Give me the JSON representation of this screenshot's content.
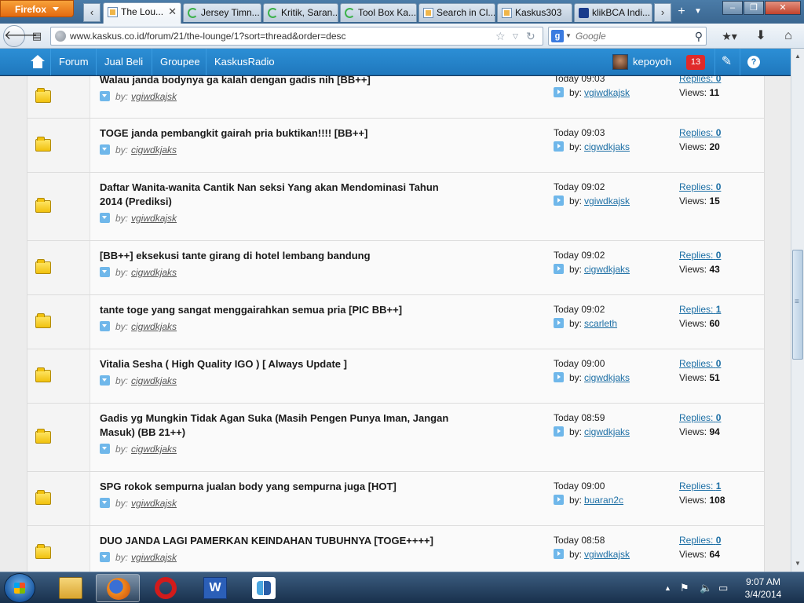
{
  "browser": {
    "menu_label": "Firefox",
    "tabs": [
      {
        "label": "The Lou...",
        "icon": "kaskus-page-icon",
        "active": true
      },
      {
        "label": "Jersey Timn...",
        "icon": "loading-icon"
      },
      {
        "label": "Kritik, Saran...",
        "icon": "loading-icon"
      },
      {
        "label": "Tool Box Ka...",
        "icon": "loading-icon"
      },
      {
        "label": "Search in Cl...",
        "icon": "kaskus-page-icon"
      },
      {
        "label": "Kaskus303",
        "icon": "kaskus-page-icon"
      },
      {
        "label": "klikBCA Indi...",
        "icon": "bca-icon"
      }
    ],
    "url": "www.kaskus.co.id/forum/21/the-lounge/1?sort=thread&order=desc",
    "search_placeholder": "Google"
  },
  "kaskus": {
    "nav": [
      "Forum",
      "Jual Beli",
      "Groupee",
      "KaskusRadio"
    ],
    "username": "kepoyoh",
    "notifications": "13"
  },
  "labels": {
    "by": "by:",
    "replies": "Replies:",
    "views": "Views:"
  },
  "threads": [
    {
      "title": "Walau janda bodynya ga kalah dengan gadis nih [BB++]",
      "author": "vgiwdkajsk",
      "time": "Today 09:03",
      "last_user": "vgiwdkajsk",
      "replies": "0",
      "views": "11"
    },
    {
      "title": "TOGE janda pembangkit gairah pria buktikan!!!! [BB++]",
      "author": "cigwdkjaks",
      "time": "Today 09:03",
      "last_user": "cigwdkjaks",
      "replies": "0",
      "views": "20"
    },
    {
      "title": "Daftar Wanita-wanita Cantik Nan seksi Yang akan Mendominasi Tahun 2014 (Prediksi)",
      "author": "vgiwdkajsk",
      "time": "Today 09:02",
      "last_user": "vgiwdkajsk",
      "replies": "0",
      "views": "15"
    },
    {
      "title": "[BB++] eksekusi tante girang di hotel lembang bandung",
      "author": "cigwdkjaks",
      "time": "Today 09:02",
      "last_user": "cigwdkjaks",
      "replies": "0",
      "views": "43"
    },
    {
      "title": "tante toge yang sangat menggairahkan semua pria [PIC BB++]",
      "author": "cigwdkjaks",
      "time": "Today 09:02",
      "last_user": "scarleth",
      "replies": "1",
      "views": "60"
    },
    {
      "title": "Vitalia Sesha ( High Quality IGO ) [ Always Update ]",
      "author": "cigwdkjaks",
      "time": "Today 09:00",
      "last_user": "cigwdkjaks",
      "replies": "0",
      "views": "51"
    },
    {
      "title": "Gadis yg Mungkin Tidak Agan Suka (Masih Pengen Punya Iman, Jangan Masuk) (BB 21++)",
      "author": "cigwdkjaks",
      "time": "Today 08:59",
      "last_user": "cigwdkjaks",
      "replies": "0",
      "views": "94"
    },
    {
      "title": "SPG rokok sempurna jualan body yang sempurna juga [HOT]",
      "author": "vgiwdkajsk",
      "time": "Today 09:00",
      "last_user": "buaran2c",
      "replies": "1",
      "views": "108"
    },
    {
      "title": "DUO JANDA LAGI PAMERKAN KEINDAHAN TUBUHNYA [TOGE++++]",
      "author": "vgiwdkajsk",
      "time": "Today 08:58",
      "last_user": "vgiwdkajsk",
      "replies": "0",
      "views": "64"
    }
  ],
  "taskbar": {
    "time": "9:07 AM",
    "date": "3/4/2014"
  }
}
